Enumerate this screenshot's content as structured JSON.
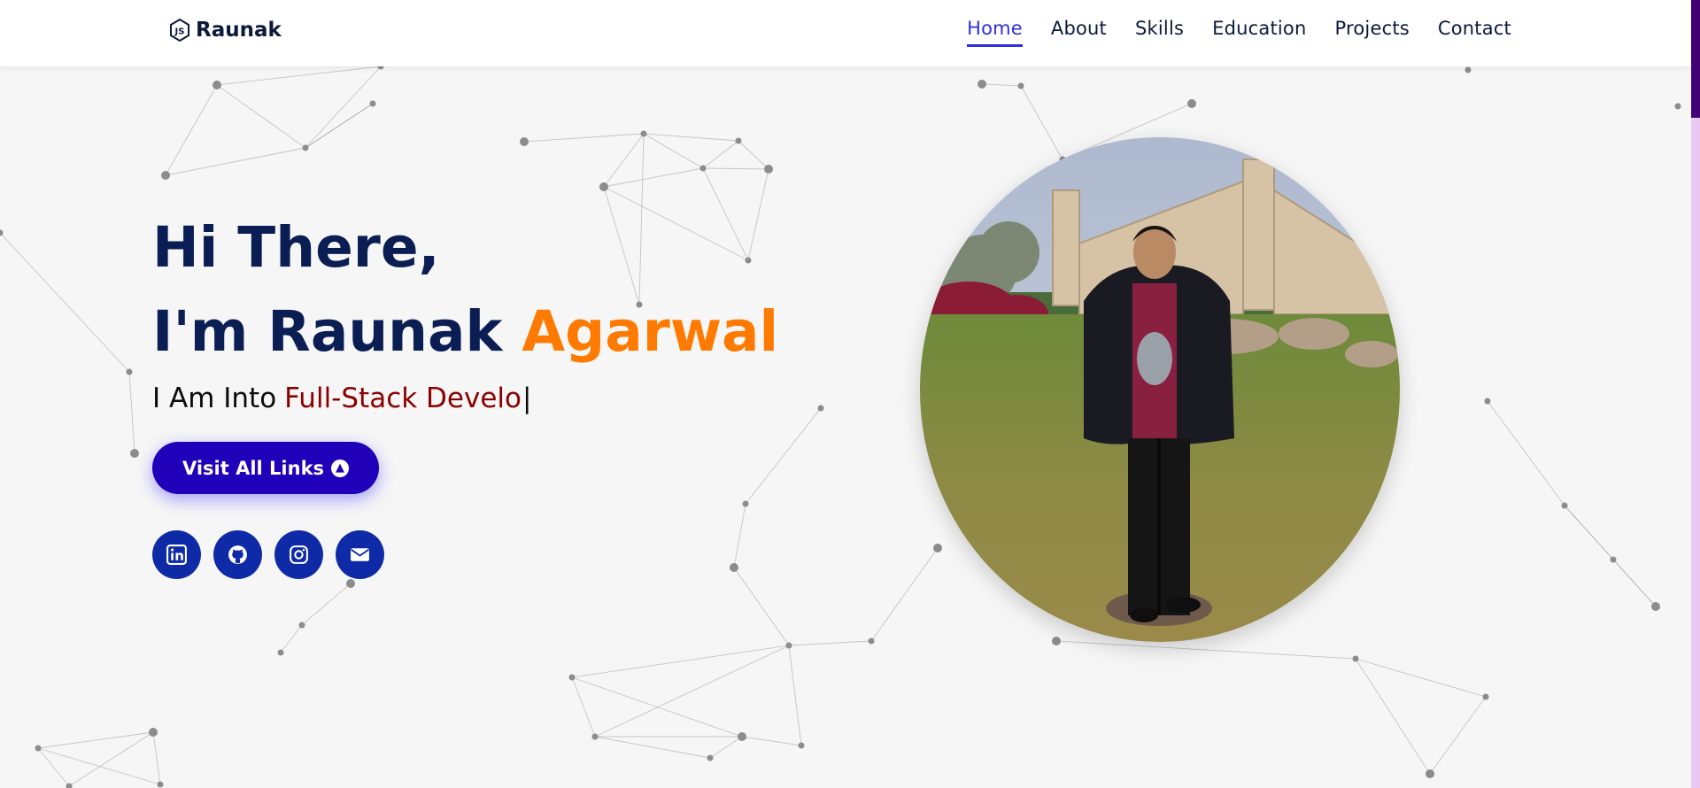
{
  "header": {
    "logo_text": "Raunak",
    "nav": [
      {
        "label": "Home",
        "active": true
      },
      {
        "label": "About"
      },
      {
        "label": "Skills"
      },
      {
        "label": "Education"
      },
      {
        "label": "Projects"
      },
      {
        "label": "Contact"
      }
    ]
  },
  "hero": {
    "greeting": "Hi There,",
    "name_prefix": "I'm Raunak",
    "name_accent": "Agarwal",
    "typing_prefix": "I Am Into",
    "typing_text": "Full-Stack Develo",
    "cursor": "|",
    "cta_label": "Visit All Links",
    "cta_icon": "arrow-circle-up-icon"
  },
  "socials": [
    {
      "icon": "linkedin-icon"
    },
    {
      "icon": "github-icon"
    },
    {
      "icon": "instagram-icon"
    },
    {
      "icon": "email-icon"
    }
  ],
  "colors": {
    "navy": "#0b1e54",
    "accent_orange": "#ff7a00",
    "typed_red": "#8b0000",
    "nav_active": "#2f2fe0",
    "button": "#2000b8",
    "social": "#0e2aa6",
    "scroll_thumb": "#420075",
    "scroll_track": "#e9c8f4"
  }
}
